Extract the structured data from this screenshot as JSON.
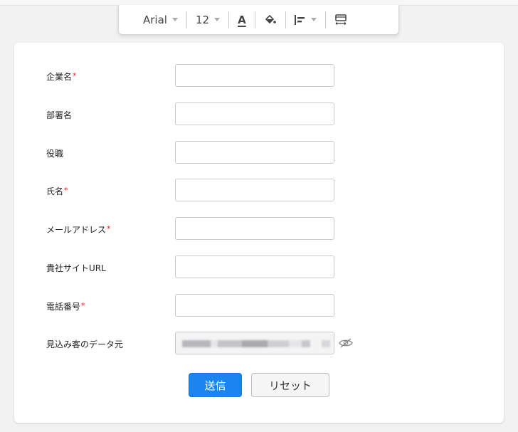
{
  "toolbar": {
    "font_family": "Arial",
    "font_size": "12",
    "font_color_glyph": "A",
    "icons": [
      "text-color-icon",
      "fill-color-icon",
      "align-left-icon",
      "layout-icon"
    ]
  },
  "form": {
    "required_mark": "*",
    "fields": [
      {
        "label": "企業名",
        "required": true,
        "value": ""
      },
      {
        "label": "部署名",
        "required": false,
        "value": ""
      },
      {
        "label": "役職",
        "required": false,
        "value": ""
      },
      {
        "label": "氏名",
        "required": true,
        "value": ""
      },
      {
        "label": "メールアドレス",
        "required": true,
        "value": ""
      },
      {
        "label": "貴社サイトURL",
        "required": false,
        "value": ""
      },
      {
        "label": "電話番号",
        "required": true,
        "value": ""
      },
      {
        "label": "見込み客のデータ元",
        "required": false,
        "value": ""
      }
    ],
    "submit_label": "送信",
    "reset_label": "リセット"
  },
  "colors": {
    "accent": "#1a84ef",
    "required": "#e02020"
  }
}
